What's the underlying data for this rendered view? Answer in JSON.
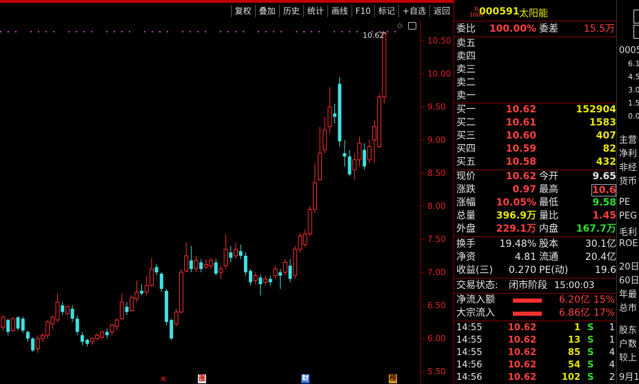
{
  "toolbar": {
    "buttons": [
      "复权",
      "叠加",
      "历史",
      "统计",
      "画线",
      "F10",
      "标记",
      "+自选",
      "返回"
    ]
  },
  "chart": {
    "y_ticks": [
      "10.50",
      "10.00",
      "9.50",
      "9.00",
      "8.50",
      "8.00",
      "7.50",
      "7.00",
      "6.50",
      "6.00",
      "5.50"
    ],
    "high_label": "10.62",
    "markers": [
      "≤",
      "涨",
      "财",
      "榜"
    ],
    "colors": {
      "up": "#ff3030",
      "down": "#40e0e0",
      "grid": "#8b0000"
    }
  },
  "chart_data": {
    "type": "candlestick",
    "ylim": [
      5.4,
      10.9
    ],
    "candles": [
      [
        6.17,
        6.32,
        6.12,
        6.35
      ],
      [
        6.28,
        6.1,
        6.05,
        6.3
      ],
      [
        6.12,
        6.3,
        6.1,
        6.32
      ],
      [
        6.32,
        6.15,
        6.12,
        6.34
      ],
      [
        6.3,
        6.12,
        6.08,
        6.33
      ],
      [
        6.1,
        6.0,
        5.95,
        6.12
      ],
      [
        6.0,
        5.82,
        5.8,
        6.02
      ],
      [
        5.85,
        6.0,
        5.78,
        6.05
      ],
      [
        6.0,
        6.05,
        5.95,
        6.08
      ],
      [
        6.05,
        6.25,
        6.0,
        6.28
      ],
      [
        6.22,
        6.32,
        6.15,
        6.35
      ],
      [
        6.28,
        6.55,
        6.25,
        6.68
      ],
      [
        6.5,
        6.4,
        6.35,
        6.55
      ],
      [
        6.38,
        6.48,
        6.34,
        6.5
      ],
      [
        6.45,
        6.3,
        6.25,
        6.5
      ],
      [
        6.3,
        6.1,
        6.05,
        6.35
      ],
      [
        6.05,
        5.95,
        5.9,
        6.1
      ],
      [
        5.98,
        5.92,
        5.88,
        6.0
      ],
      [
        5.95,
        6.0,
        5.9,
        6.02
      ],
      [
        6.0,
        6.05,
        5.97,
        6.08
      ],
      [
        6.02,
        6.1,
        5.99,
        6.12
      ],
      [
        6.1,
        6.05,
        6.0,
        6.15
      ],
      [
        6.1,
        6.2,
        6.05,
        6.22
      ],
      [
        6.18,
        6.28,
        6.12,
        6.3
      ],
      [
        6.3,
        6.55,
        6.28,
        6.68
      ],
      [
        6.48,
        6.4,
        6.35,
        6.55
      ],
      [
        6.42,
        6.62,
        6.4,
        6.65
      ],
      [
        6.6,
        6.7,
        6.55,
        6.88
      ],
      [
        6.72,
        6.68,
        6.65,
        6.82
      ],
      [
        6.7,
        6.8,
        6.65,
        6.95
      ],
      [
        6.8,
        7.05,
        6.78,
        7.22
      ],
      [
        7.08,
        7.0,
        6.95,
        7.12
      ],
      [
        6.98,
        6.75,
        6.7,
        7.0
      ],
      [
        6.72,
        6.25,
        6.2,
        6.75
      ],
      [
        6.28,
        6.0,
        5.98,
        6.3
      ],
      [
        6.22,
        6.4,
        6.18,
        6.45
      ],
      [
        6.4,
        7.0,
        6.38,
        7.05
      ],
      [
        7.02,
        7.25,
        7.0,
        7.45
      ],
      [
        7.18,
        7.05,
        7.0,
        7.4
      ],
      [
        7.06,
        7.18,
        7.0,
        7.25
      ],
      [
        7.15,
        7.05,
        7.0,
        7.2
      ],
      [
        7.08,
        7.12,
        7.05,
        7.2
      ],
      [
        7.1,
        7.18,
        7.05,
        7.22
      ],
      [
        7.15,
        6.98,
        6.95,
        7.2
      ],
      [
        7.0,
        7.05,
        6.9,
        7.1
      ],
      [
        7.1,
        7.35,
        7.05,
        7.58
      ],
      [
        7.3,
        7.22,
        7.15,
        7.4
      ],
      [
        7.25,
        7.35,
        7.2,
        7.45
      ],
      [
        7.32,
        7.25,
        7.2,
        7.42
      ],
      [
        7.25,
        7.0,
        6.95,
        7.3
      ],
      [
        7.02,
        6.85,
        6.8,
        7.05
      ],
      [
        6.88,
        6.95,
        6.82,
        7.0
      ],
      [
        6.92,
        6.82,
        6.65,
        6.97
      ],
      [
        6.85,
        6.9,
        6.8,
        6.95
      ],
      [
        6.9,
        6.85,
        6.8,
        6.95
      ],
      [
        6.95,
        7.05,
        6.9,
        7.1
      ],
      [
        7.0,
        6.95,
        6.75,
        7.05
      ],
      [
        7.0,
        7.15,
        6.95,
        7.2
      ],
      [
        7.1,
        6.9,
        6.85,
        7.2
      ],
      [
        6.95,
        7.35,
        6.9,
        7.4
      ],
      [
        7.35,
        7.55,
        7.3,
        7.6
      ],
      [
        7.42,
        7.58,
        7.38,
        7.65
      ],
      [
        7.58,
        7.95,
        7.55,
        8.0
      ],
      [
        7.95,
        8.35,
        7.9,
        8.65
      ],
      [
        8.4,
        8.8,
        8.38,
        9.2
      ],
      [
        8.85,
        9.15,
        8.8,
        9.35
      ],
      [
        9.2,
        9.5,
        9.1,
        9.8
      ],
      [
        9.4,
        9.35,
        9.25,
        9.55
      ],
      [
        9.85,
        8.98,
        8.9,
        9.95
      ],
      [
        8.8,
        8.75,
        8.6,
        9.0
      ],
      [
        8.75,
        8.48,
        8.45,
        8.85
      ],
      [
        8.55,
        8.7,
        8.4,
        8.8
      ],
      [
        8.7,
        8.95,
        8.6,
        9.05
      ],
      [
        8.85,
        8.6,
        8.55,
        8.95
      ],
      [
        8.7,
        8.9,
        8.65,
        9.0
      ],
      [
        9.0,
        9.2,
        8.65,
        9.3
      ],
      [
        8.9,
        9.65,
        8.88,
        9.7
      ],
      [
        9.65,
        10.62,
        9.55,
        10.62
      ]
    ]
  },
  "panel": {
    "header": {
      "tag_top": "R",
      "tag_bottom": "1000",
      "code": "000591",
      "name": "太阳能"
    },
    "wb": [
      {
        "label": "委比",
        "value": "100.00%"
      },
      {
        "label": "委差",
        "value": "15.5万"
      }
    ],
    "asks": [
      "卖五",
      "卖四",
      "卖三",
      "卖二",
      "卖一"
    ],
    "bids": [
      {
        "label": "买一",
        "price": "10.62",
        "vol": "152904"
      },
      {
        "label": "买二",
        "price": "10.61",
        "vol": "1583"
      },
      {
        "label": "买三",
        "price": "10.60",
        "vol": "407"
      },
      {
        "label": "买四",
        "price": "10.59",
        "vol": "82"
      },
      {
        "label": "买五",
        "price": "10.58",
        "vol": "432"
      }
    ],
    "stats": [
      {
        "l1": "现价",
        "v1": "10.62",
        "c1": "red",
        "l2": "今开",
        "v2": "9.65",
        "c2": "white"
      },
      {
        "l1": "涨跌",
        "v1": "0.97",
        "c1": "red",
        "l2": "最高",
        "v2": "10.62",
        "c2": "red"
      },
      {
        "l1": "涨幅",
        "v1": "10.05%",
        "c1": "red",
        "l2": "最低",
        "v2": "9.58",
        "c2": "green"
      },
      {
        "l1": "总量",
        "v1": "396.9万",
        "c1": "yellow",
        "l2": "量比",
        "v2": "1.45",
        "c2": "red"
      },
      {
        "l1": "外盘",
        "v1": "229.1万",
        "c1": "red",
        "l2": "内盘",
        "v2": "167.7万",
        "c2": "green"
      }
    ],
    "stats2": [
      {
        "l1": "换手",
        "v1": "19.48%",
        "l2": "股本",
        "v2": "30.1亿"
      },
      {
        "l1": "净资",
        "v1": "4.81",
        "l2": "流通",
        "v2": "20.4亿"
      },
      {
        "l1": "收益(三)",
        "v1": "0.270",
        "l2": "PE(动)",
        "v2": "19.6"
      }
    ],
    "status": {
      "label": "交易状态:",
      "value": "闭市阶段",
      "time": "15:00:03"
    },
    "flows": [
      {
        "label": "净流入额",
        "amount": "6.20亿",
        "pct": "15%"
      },
      {
        "label": "大宗流入",
        "amount": "6.86亿",
        "pct": "17%"
      }
    ],
    "trades": [
      {
        "time": "14:55",
        "price": "10.62",
        "vol": "1",
        "side": "S",
        "extra": "1"
      },
      {
        "time": "14:55",
        "price": "10.62",
        "vol": "13",
        "side": "S",
        "extra": "1"
      },
      {
        "time": "14:55",
        "price": "10.62",
        "vol": "85",
        "side": "S",
        "extra": "4"
      },
      {
        "time": "14:56",
        "price": "10.62",
        "vol": "54",
        "side": "S",
        "extra": "4"
      },
      {
        "time": "14:56",
        "price": "10.62",
        "vol": "102",
        "side": "S",
        "extra": "2"
      }
    ]
  },
  "edge": {
    "items": [
      "0005",
      "6.1",
      "4.5",
      "3.0",
      "1.5",
      "0.0",
      "主营",
      "净利",
      "非经",
      "货币",
      "PE",
      "PEG",
      "毛利",
      "ROE",
      "20日",
      "60日",
      "年最",
      "总市",
      "股东",
      "户数",
      "较上",
      "9月1"
    ]
  }
}
